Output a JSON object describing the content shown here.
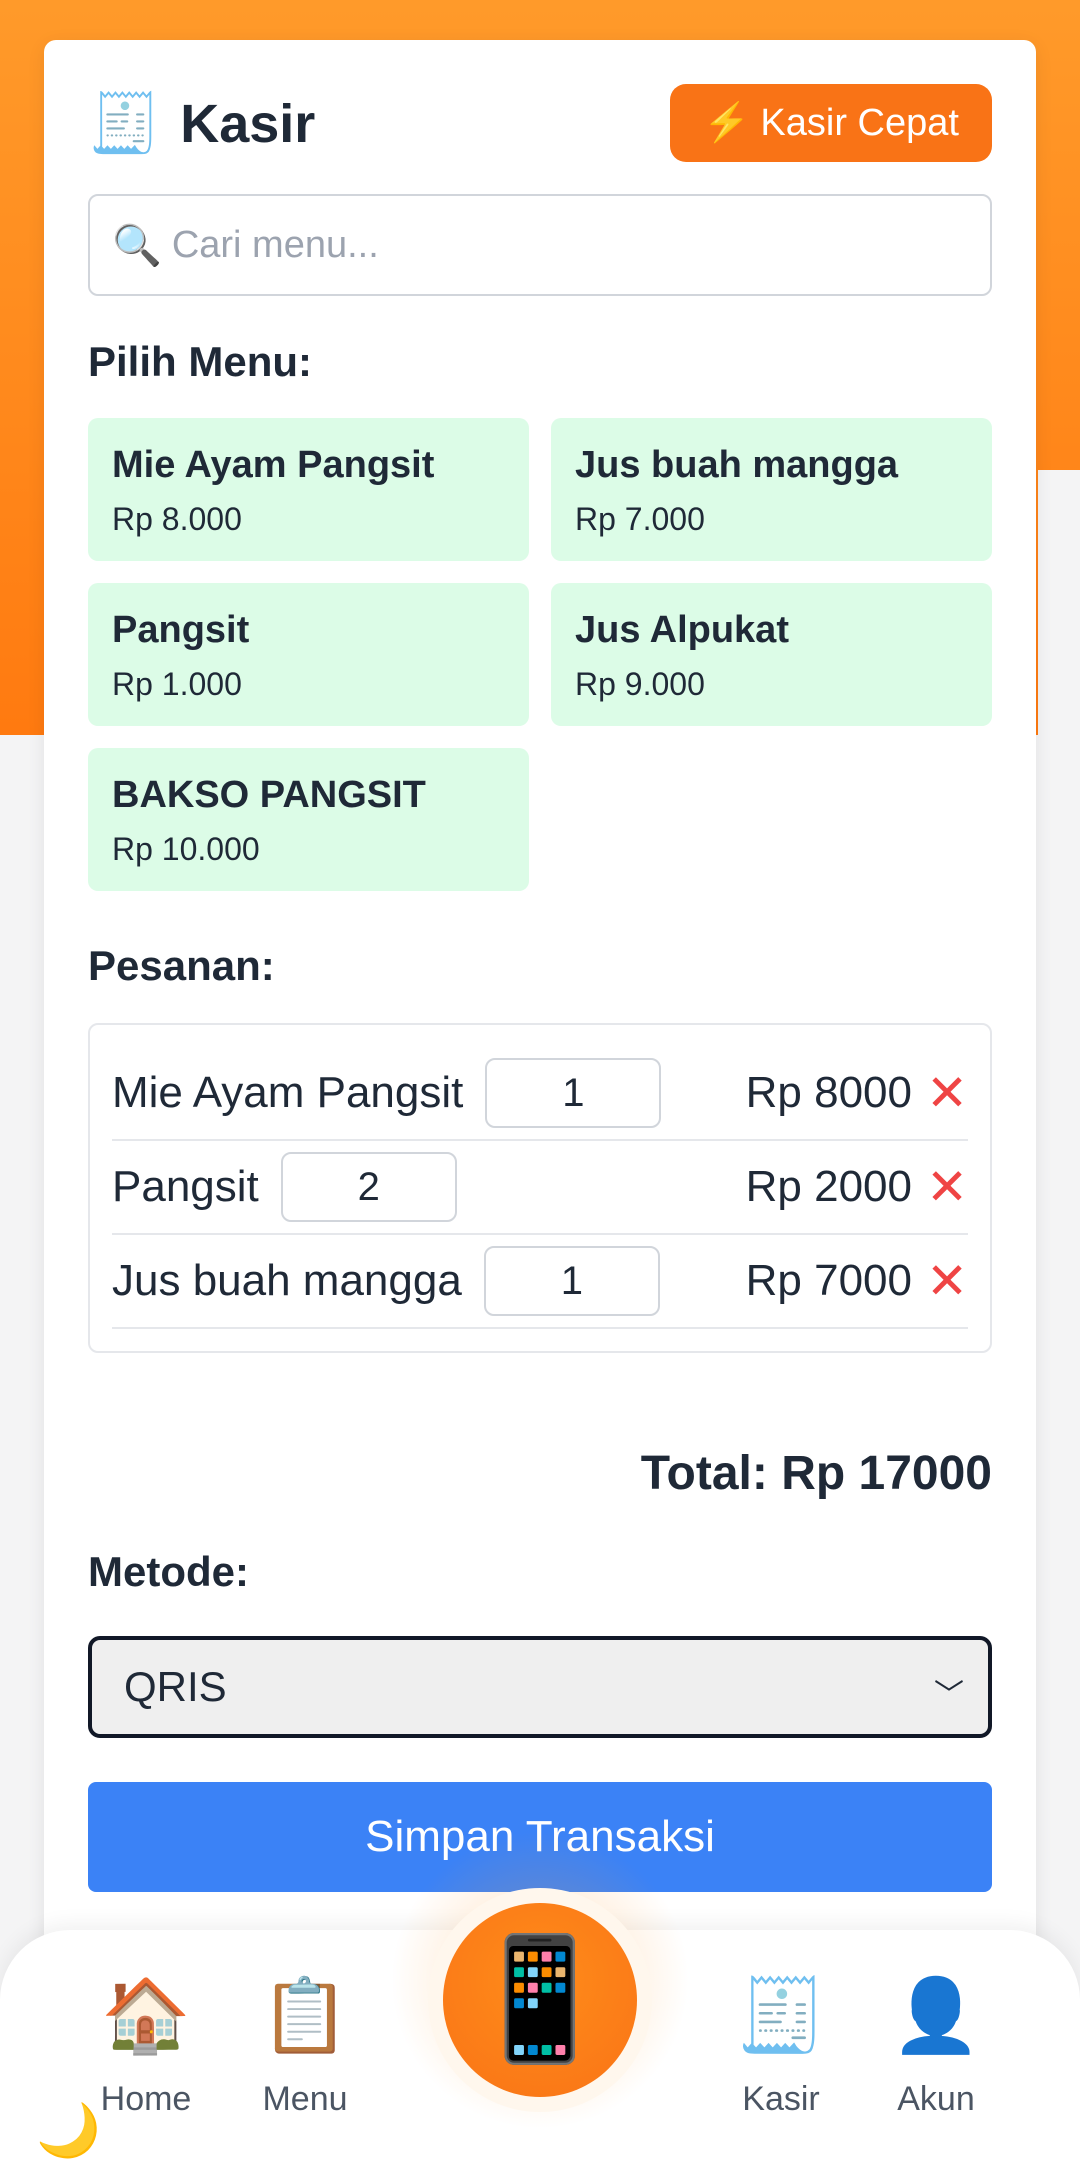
{
  "header": {
    "title_icon": "🧾",
    "title": "Kasir",
    "quick_button_icon": "⚡",
    "quick_button_label": "Kasir Cepat"
  },
  "search": {
    "icon": "🔍",
    "placeholder": "Cari menu..."
  },
  "menu_section": {
    "label": "Pilih Menu:",
    "items": [
      {
        "name": "Mie Ayam Pangsit",
        "price": "Rp 8.000"
      },
      {
        "name": "Jus buah mangga",
        "price": "Rp 7.000"
      },
      {
        "name": "Pangsit",
        "price": "Rp 1.000"
      },
      {
        "name": "Jus Alpukat",
        "price": "Rp 9.000"
      },
      {
        "name": "BAKSO PANGSIT",
        "price": "Rp 10.000"
      }
    ]
  },
  "order_section": {
    "label": "Pesanan:",
    "items": [
      {
        "name": "Mie Ayam Pangsit",
        "qty": "1",
        "subtotal": "Rp 8000",
        "remove": "✕"
      },
      {
        "name": "Pangsit",
        "qty": "2",
        "subtotal": "Rp 2000",
        "remove": "✕"
      },
      {
        "name": "Jus buah mangga",
        "qty": "1",
        "subtotal": "Rp 7000",
        "remove": "✕"
      }
    ]
  },
  "total": "Total: Rp 17000",
  "payment": {
    "label": "Metode:",
    "selected": "QRIS",
    "chevron": "﹀"
  },
  "save_button": "Simpan Transaksi",
  "bottom_nav": {
    "items": [
      {
        "icon": "🏠",
        "label": "Home"
      },
      {
        "icon": "📋",
        "label": "Menu"
      },
      {
        "icon": "🧾",
        "label": "Kasir"
      },
      {
        "icon": "👤",
        "label": "Akun"
      }
    ],
    "center_icon": "📱",
    "theme_icon": "🌙"
  },
  "colors": {
    "header_gradient_top": "#ff9a2a",
    "header_gradient_bottom": "#ff7a10",
    "accent_orange": "#f97316",
    "menu_card_bg": "#dcfce7",
    "primary_blue": "#3b82f6",
    "remove_red": "#ef4444"
  }
}
